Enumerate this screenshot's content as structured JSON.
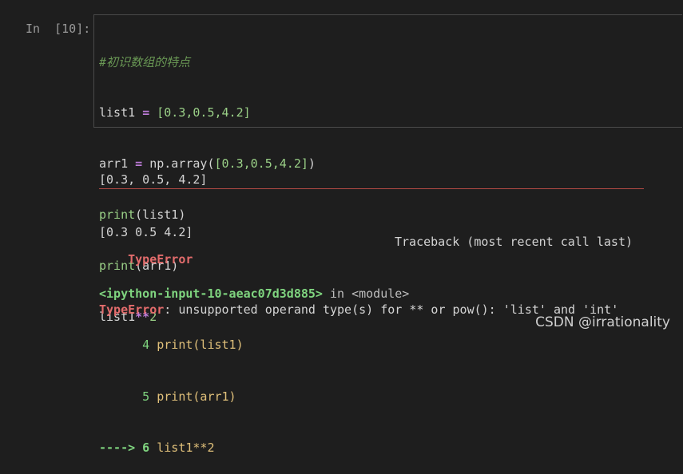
{
  "cell": {
    "prompt": "In  [10]:",
    "code_lines": [
      "#初识数组的特点",
      "list1 = [0.3,0.5,4.2]",
      "arr1 = np.array([0.3,0.5,4.2])",
      "print(list1)",
      "print(arr1)",
      "list1**2"
    ]
  },
  "output": {
    "lines": [
      "[0.3, 0.5, 4.2]",
      "[0.3 0.5 4.2]"
    ]
  },
  "traceback": {
    "error_name": "TypeError",
    "header_right": "Traceback (most recent call last)",
    "location_file": "<ipython-input-10-aeac07d3d885>",
    "location_in": " in ",
    "location_module": "<module>",
    "frames": [
      {
        "prefix": "      4 ",
        "code": "print(list1)"
      },
      {
        "prefix": "      5 ",
        "code": "print(arr1)"
      },
      {
        "prefix": "----> 6 ",
        "code": "list1**2"
      }
    ],
    "final_error_name": "TypeError",
    "final_message": ": unsupported operand type(s) for ** or pow(): 'list' and 'int'"
  },
  "watermark": "CSDN @irrationality"
}
